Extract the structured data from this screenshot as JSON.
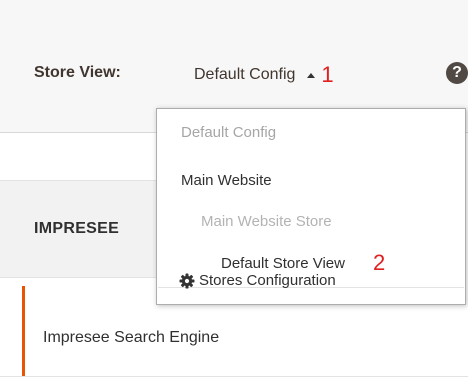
{
  "store_bar": {
    "label": "Store View:",
    "current_scope": "Default Config",
    "caret_icon": "caret-up-icon",
    "annotation": "1",
    "help_icon_glyph": "?"
  },
  "section": {
    "title": "IMPRESEE",
    "item_label": "Impresee Search Engine",
    "accent_color": "#eb5202"
  },
  "dropdown": {
    "items": [
      {
        "label": "Default Config",
        "state": "disabled"
      },
      {
        "label": "Main Website",
        "state": "enabled"
      },
      {
        "label": "Main Website Store",
        "state": "disabled"
      },
      {
        "label": "Default Store View",
        "state": "enabled"
      }
    ],
    "annotation": "2",
    "footer_icon": "gear-icon",
    "footer_label": "Stores Configuration"
  },
  "colors": {
    "annotation": "#e02020",
    "help_icon_bg": "#514943"
  }
}
